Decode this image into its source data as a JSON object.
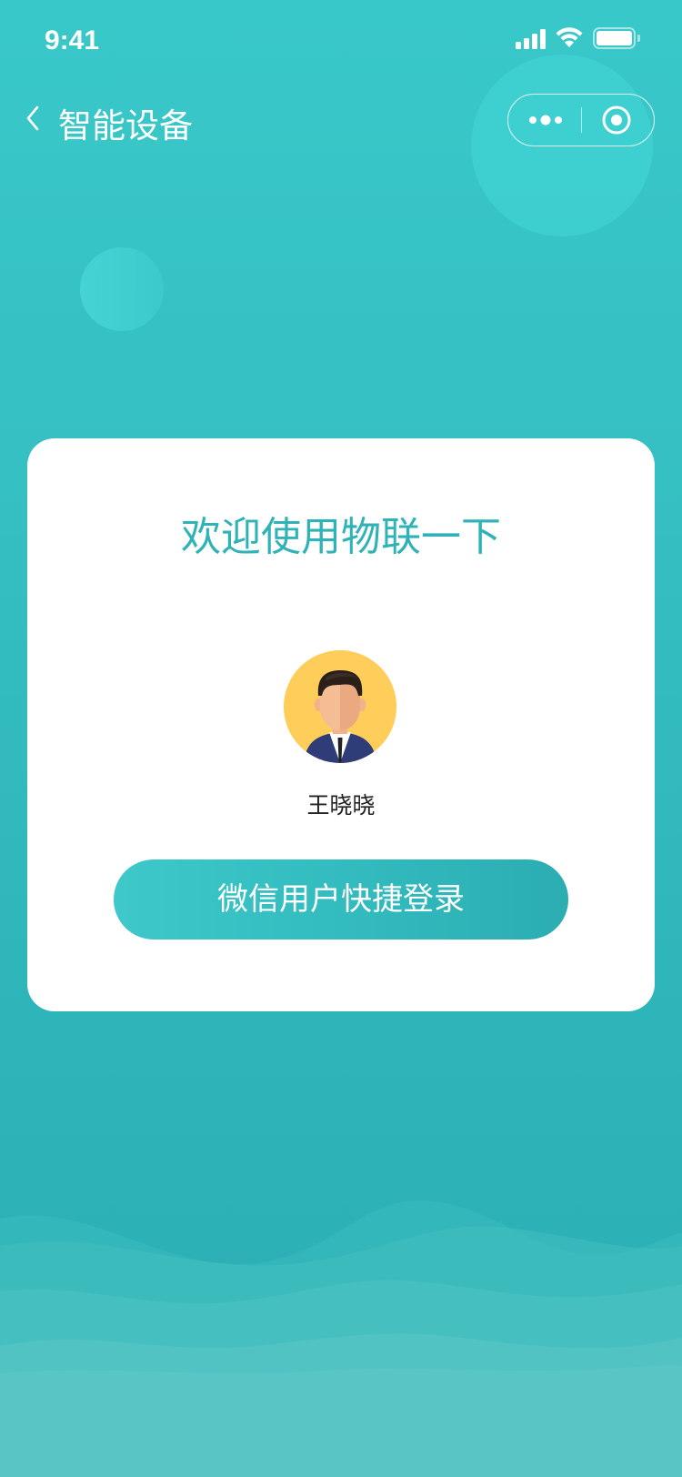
{
  "status_bar": {
    "time": "9:41"
  },
  "nav": {
    "title": "智能设备",
    "back_icon": "chevron-left-icon",
    "more_icon": "more-dots-icon",
    "close_icon": "target-circle-icon"
  },
  "card": {
    "welcome": "欢迎使用物联一下",
    "user_name": "王晓晓",
    "login_label": "微信用户快捷登录"
  },
  "colors": {
    "background_top": "#39c8c9",
    "background_bottom": "#2aadb3",
    "accent": "#2fb3b6",
    "card": "#ffffff",
    "avatar_bg": "#ffcd5a"
  }
}
